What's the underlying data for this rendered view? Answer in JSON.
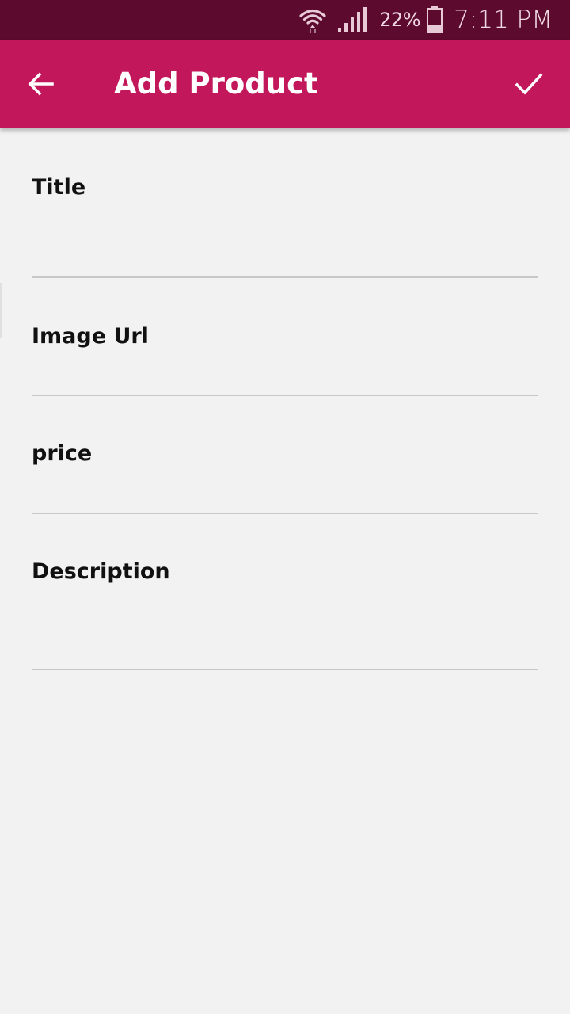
{
  "status_bar": {
    "battery": "22%",
    "time": "7:11 PM",
    "icons": [
      "wifi-icon",
      "signal-icon",
      "battery-icon"
    ]
  },
  "app_bar": {
    "title": "Add Product",
    "back_icon": "arrow-back-icon",
    "confirm_icon": "check-icon",
    "color": "#c2185b"
  },
  "form": {
    "fields": [
      {
        "label": "Title",
        "value": ""
      },
      {
        "label": "Image Url",
        "value": ""
      },
      {
        "label": "price",
        "value": ""
      },
      {
        "label": "Description",
        "value": ""
      }
    ]
  }
}
